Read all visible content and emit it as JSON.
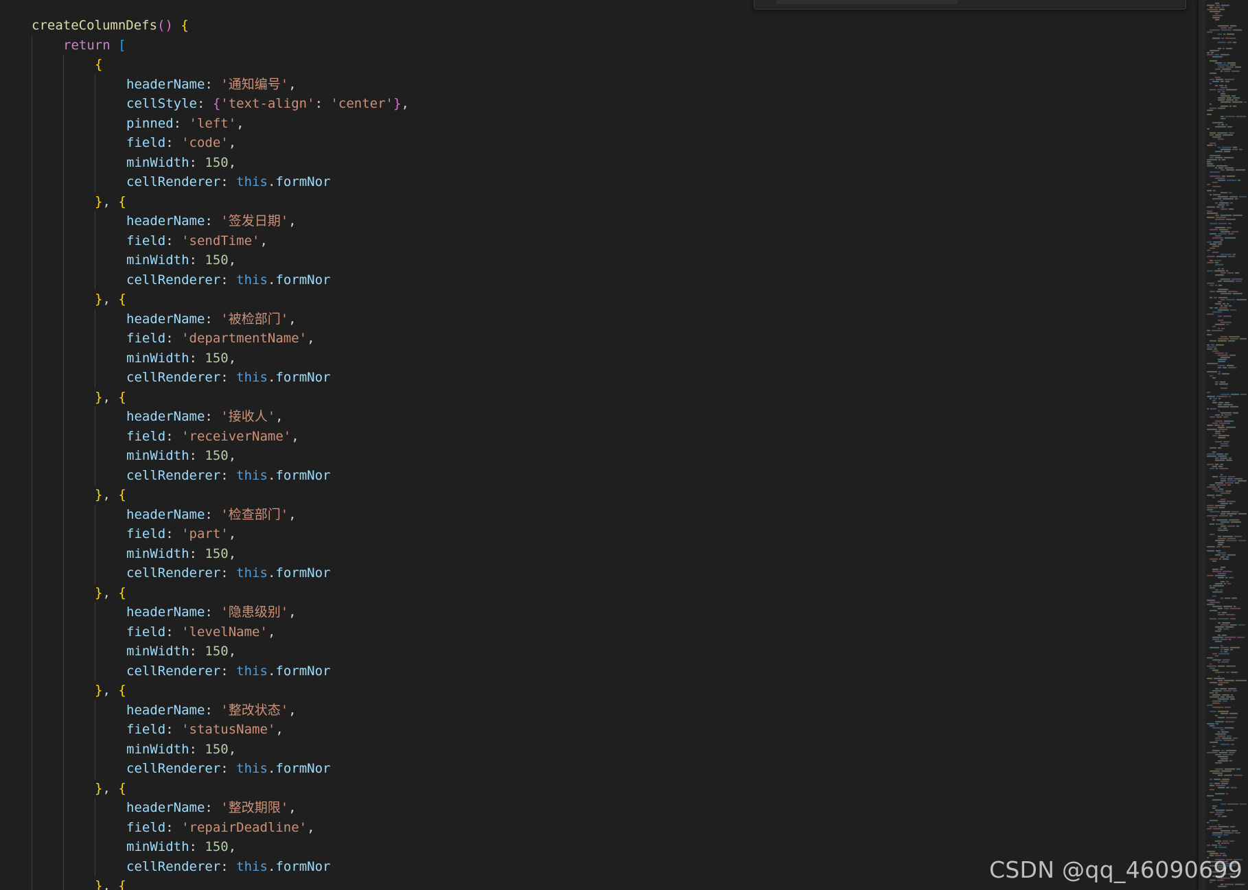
{
  "editor": {
    "language": "javascript",
    "colors": {
      "background": "#1f1f1f",
      "function": "#dcdcaa",
      "keyword": "#c586c0",
      "this": "#569cd6",
      "property": "#9cdcfe",
      "string": "#ce9178",
      "number": "#b5cea8",
      "punctuation": "#d4d4d4",
      "bracket_level_1": "#ffd700",
      "bracket_level_2": "#da70d6",
      "bracket_level_3": "#179fff"
    },
    "lines": [
      {
        "indent": 1,
        "tokens": [
          [
            "fn",
            "createColumnDefs"
          ],
          [
            "b2",
            "()"
          ],
          [
            "punc",
            " "
          ],
          [
            "b1",
            "{"
          ]
        ]
      },
      {
        "indent": 2,
        "tokens": [
          [
            "kw",
            "return"
          ],
          [
            "punc",
            " "
          ],
          [
            "b3",
            "["
          ]
        ]
      },
      {
        "indent": 3,
        "tokens": [
          [
            "b1",
            "{"
          ]
        ]
      },
      {
        "indent": 4,
        "tokens": [
          [
            "prop",
            "headerName"
          ],
          [
            "punc",
            ": "
          ],
          [
            "str",
            "'通知编号'"
          ],
          [
            "punc",
            ","
          ]
        ]
      },
      {
        "indent": 4,
        "tokens": [
          [
            "prop",
            "cellStyle"
          ],
          [
            "punc",
            ": "
          ],
          [
            "b2",
            "{"
          ],
          [
            "str",
            "'text-align'"
          ],
          [
            "punc",
            ": "
          ],
          [
            "str",
            "'center'"
          ],
          [
            "b2",
            "}"
          ],
          [
            "punc",
            ","
          ]
        ]
      },
      {
        "indent": 4,
        "tokens": [
          [
            "prop",
            "pinned"
          ],
          [
            "punc",
            ": "
          ],
          [
            "str",
            "'left'"
          ],
          [
            "punc",
            ","
          ]
        ]
      },
      {
        "indent": 4,
        "tokens": [
          [
            "prop",
            "field"
          ],
          [
            "punc",
            ": "
          ],
          [
            "str",
            "'code'"
          ],
          [
            "punc",
            ","
          ]
        ]
      },
      {
        "indent": 4,
        "tokens": [
          [
            "prop",
            "minWidth"
          ],
          [
            "punc",
            ": "
          ],
          [
            "num",
            "150"
          ],
          [
            "punc",
            ","
          ]
        ]
      },
      {
        "indent": 4,
        "tokens": [
          [
            "prop",
            "cellRenderer"
          ],
          [
            "punc",
            ": "
          ],
          [
            "this",
            "this"
          ],
          [
            "punc",
            "."
          ],
          [
            "prop",
            "formNor"
          ]
        ]
      },
      {
        "indent": 3,
        "tokens": [
          [
            "b1",
            "}"
          ],
          [
            "punc",
            ", "
          ],
          [
            "b1",
            "{"
          ]
        ]
      },
      {
        "indent": 4,
        "tokens": [
          [
            "prop",
            "headerName"
          ],
          [
            "punc",
            ": "
          ],
          [
            "str",
            "'签发日期'"
          ],
          [
            "punc",
            ","
          ]
        ]
      },
      {
        "indent": 4,
        "tokens": [
          [
            "prop",
            "field"
          ],
          [
            "punc",
            ": "
          ],
          [
            "str",
            "'sendTime'"
          ],
          [
            "punc",
            ","
          ]
        ]
      },
      {
        "indent": 4,
        "tokens": [
          [
            "prop",
            "minWidth"
          ],
          [
            "punc",
            ": "
          ],
          [
            "num",
            "150"
          ],
          [
            "punc",
            ","
          ]
        ]
      },
      {
        "indent": 4,
        "tokens": [
          [
            "prop",
            "cellRenderer"
          ],
          [
            "punc",
            ": "
          ],
          [
            "this",
            "this"
          ],
          [
            "punc",
            "."
          ],
          [
            "prop",
            "formNor"
          ]
        ]
      },
      {
        "indent": 3,
        "tokens": [
          [
            "b1",
            "}"
          ],
          [
            "punc",
            ", "
          ],
          [
            "b1",
            "{"
          ]
        ]
      },
      {
        "indent": 4,
        "tokens": [
          [
            "prop",
            "headerName"
          ],
          [
            "punc",
            ": "
          ],
          [
            "str",
            "'被检部门'"
          ],
          [
            "punc",
            ","
          ]
        ]
      },
      {
        "indent": 4,
        "tokens": [
          [
            "prop",
            "field"
          ],
          [
            "punc",
            ": "
          ],
          [
            "str",
            "'departmentName'"
          ],
          [
            "punc",
            ","
          ]
        ]
      },
      {
        "indent": 4,
        "tokens": [
          [
            "prop",
            "minWidth"
          ],
          [
            "punc",
            ": "
          ],
          [
            "num",
            "150"
          ],
          [
            "punc",
            ","
          ]
        ]
      },
      {
        "indent": 4,
        "tokens": [
          [
            "prop",
            "cellRenderer"
          ],
          [
            "punc",
            ": "
          ],
          [
            "this",
            "this"
          ],
          [
            "punc",
            "."
          ],
          [
            "prop",
            "formNor"
          ]
        ]
      },
      {
        "indent": 3,
        "tokens": [
          [
            "b1",
            "}"
          ],
          [
            "punc",
            ", "
          ],
          [
            "b1",
            "{"
          ]
        ]
      },
      {
        "indent": 4,
        "tokens": [
          [
            "prop",
            "headerName"
          ],
          [
            "punc",
            ": "
          ],
          [
            "str",
            "'接收人'"
          ],
          [
            "punc",
            ","
          ]
        ]
      },
      {
        "indent": 4,
        "tokens": [
          [
            "prop",
            "field"
          ],
          [
            "punc",
            ": "
          ],
          [
            "str",
            "'receiverName'"
          ],
          [
            "punc",
            ","
          ]
        ]
      },
      {
        "indent": 4,
        "tokens": [
          [
            "prop",
            "minWidth"
          ],
          [
            "punc",
            ": "
          ],
          [
            "num",
            "150"
          ],
          [
            "punc",
            ","
          ]
        ]
      },
      {
        "indent": 4,
        "tokens": [
          [
            "prop",
            "cellRenderer"
          ],
          [
            "punc",
            ": "
          ],
          [
            "this",
            "this"
          ],
          [
            "punc",
            "."
          ],
          [
            "prop",
            "formNor"
          ]
        ]
      },
      {
        "indent": 3,
        "tokens": [
          [
            "b1",
            "}"
          ],
          [
            "punc",
            ", "
          ],
          [
            "b1",
            "{"
          ]
        ]
      },
      {
        "indent": 4,
        "tokens": [
          [
            "prop",
            "headerName"
          ],
          [
            "punc",
            ": "
          ],
          [
            "str",
            "'检查部门'"
          ],
          [
            "punc",
            ","
          ]
        ]
      },
      {
        "indent": 4,
        "tokens": [
          [
            "prop",
            "field"
          ],
          [
            "punc",
            ": "
          ],
          [
            "str",
            "'part'"
          ],
          [
            "punc",
            ","
          ]
        ]
      },
      {
        "indent": 4,
        "tokens": [
          [
            "prop",
            "minWidth"
          ],
          [
            "punc",
            ": "
          ],
          [
            "num",
            "150"
          ],
          [
            "punc",
            ","
          ]
        ]
      },
      {
        "indent": 4,
        "tokens": [
          [
            "prop",
            "cellRenderer"
          ],
          [
            "punc",
            ": "
          ],
          [
            "this",
            "this"
          ],
          [
            "punc",
            "."
          ],
          [
            "prop",
            "formNor"
          ]
        ]
      },
      {
        "indent": 3,
        "tokens": [
          [
            "b1",
            "}"
          ],
          [
            "punc",
            ", "
          ],
          [
            "b1",
            "{"
          ]
        ]
      },
      {
        "indent": 4,
        "tokens": [
          [
            "prop",
            "headerName"
          ],
          [
            "punc",
            ": "
          ],
          [
            "str",
            "'隐患级别'"
          ],
          [
            "punc",
            ","
          ]
        ]
      },
      {
        "indent": 4,
        "tokens": [
          [
            "prop",
            "field"
          ],
          [
            "punc",
            ": "
          ],
          [
            "str",
            "'levelName'"
          ],
          [
            "punc",
            ","
          ]
        ]
      },
      {
        "indent": 4,
        "tokens": [
          [
            "prop",
            "minWidth"
          ],
          [
            "punc",
            ": "
          ],
          [
            "num",
            "150"
          ],
          [
            "punc",
            ","
          ]
        ]
      },
      {
        "indent": 4,
        "tokens": [
          [
            "prop",
            "cellRenderer"
          ],
          [
            "punc",
            ": "
          ],
          [
            "this",
            "this"
          ],
          [
            "punc",
            "."
          ],
          [
            "prop",
            "formNor"
          ]
        ]
      },
      {
        "indent": 3,
        "tokens": [
          [
            "b1",
            "}"
          ],
          [
            "punc",
            ", "
          ],
          [
            "b1",
            "{"
          ]
        ]
      },
      {
        "indent": 4,
        "tokens": [
          [
            "prop",
            "headerName"
          ],
          [
            "punc",
            ": "
          ],
          [
            "str",
            "'整改状态'"
          ],
          [
            "punc",
            ","
          ]
        ]
      },
      {
        "indent": 4,
        "tokens": [
          [
            "prop",
            "field"
          ],
          [
            "punc",
            ": "
          ],
          [
            "str",
            "'statusName'"
          ],
          [
            "punc",
            ","
          ]
        ]
      },
      {
        "indent": 4,
        "tokens": [
          [
            "prop",
            "minWidth"
          ],
          [
            "punc",
            ": "
          ],
          [
            "num",
            "150"
          ],
          [
            "punc",
            ","
          ]
        ]
      },
      {
        "indent": 4,
        "tokens": [
          [
            "prop",
            "cellRenderer"
          ],
          [
            "punc",
            ": "
          ],
          [
            "this",
            "this"
          ],
          [
            "punc",
            "."
          ],
          [
            "prop",
            "formNor"
          ]
        ]
      },
      {
        "indent": 3,
        "tokens": [
          [
            "b1",
            "}"
          ],
          [
            "punc",
            ", "
          ],
          [
            "b1",
            "{"
          ]
        ]
      },
      {
        "indent": 4,
        "tokens": [
          [
            "prop",
            "headerName"
          ],
          [
            "punc",
            ": "
          ],
          [
            "str",
            "'整改期限'"
          ],
          [
            "punc",
            ","
          ]
        ]
      },
      {
        "indent": 4,
        "tokens": [
          [
            "prop",
            "field"
          ],
          [
            "punc",
            ": "
          ],
          [
            "str",
            "'repairDeadline'"
          ],
          [
            "punc",
            ","
          ]
        ]
      },
      {
        "indent": 4,
        "tokens": [
          [
            "prop",
            "minWidth"
          ],
          [
            "punc",
            ": "
          ],
          [
            "num",
            "150"
          ],
          [
            "punc",
            ","
          ]
        ]
      },
      {
        "indent": 4,
        "tokens": [
          [
            "prop",
            "cellRenderer"
          ],
          [
            "punc",
            ": "
          ],
          [
            "this",
            "this"
          ],
          [
            "punc",
            "."
          ],
          [
            "prop",
            "formNor"
          ]
        ]
      },
      {
        "indent": 3,
        "tokens": [
          [
            "b1",
            "}"
          ],
          [
            "punc",
            ", "
          ],
          [
            "b1",
            "{"
          ]
        ]
      }
    ]
  },
  "watermark": {
    "text": "CSDN @qq_46090699"
  }
}
